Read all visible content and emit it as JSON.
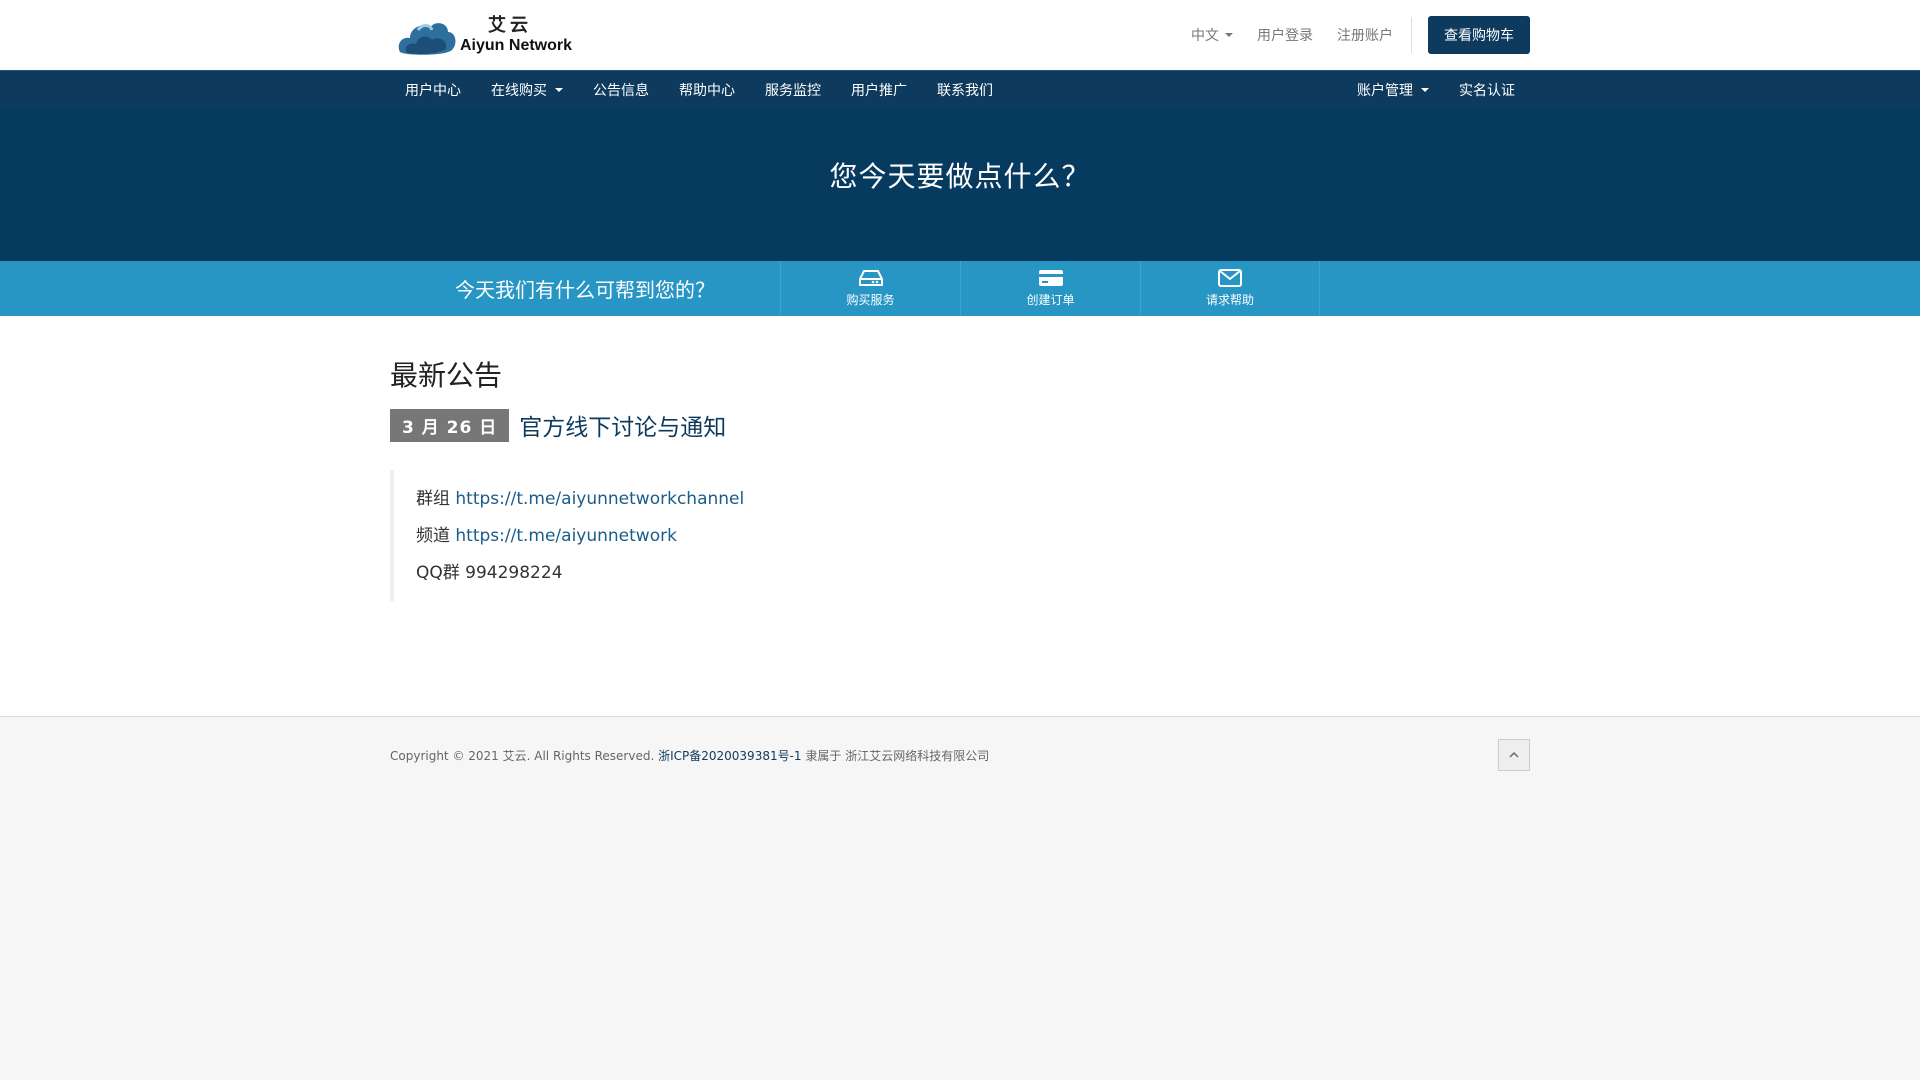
{
  "brand": {
    "name_cn": "艾云",
    "name_en": "Aiyun Network"
  },
  "topbar": {
    "language": "中文",
    "login": "用户登录",
    "register": "注册账户",
    "cart": "查看购物车"
  },
  "nav": {
    "left": [
      "用户中心",
      "在线购买",
      "公告信息",
      "帮助中心",
      "服务监控",
      "用户推广",
      "联系我们"
    ],
    "right": [
      "账户管理",
      "实名认证"
    ]
  },
  "hero": {
    "title": "您今天要做点什么？"
  },
  "strip": {
    "title": "今天我们有什么可帮到您的？",
    "items": [
      {
        "label": "购买服务",
        "icon": "hdd-icon"
      },
      {
        "label": "创建订单",
        "icon": "credit-card-icon"
      },
      {
        "label": "请求帮助",
        "icon": "envelope-icon"
      }
    ]
  },
  "announcements": {
    "section_title": "最新公告",
    "items": [
      {
        "date": "3 月 26 日",
        "title": "官方线下讨论与通知",
        "lines": [
          {
            "prefix": "群组 ",
            "link": "https://t.me/aiyunnetworkchannel"
          },
          {
            "prefix": "频道 ",
            "link": "https://t.me/aiyunnetwork"
          },
          {
            "prefix": "QQ群 994298224",
            "link": ""
          }
        ]
      }
    ]
  },
  "footer": {
    "copyright": "Copyright © 2021 艾云. All Rights Reserved. ",
    "icp": "浙ICP备2020039381号-1",
    "owner": " 隶属于 浙江艾云网络科技有限公司"
  },
  "colors": {
    "primary": "#0e3a5e",
    "hero": "#073a5f",
    "accent": "#2796c5"
  }
}
